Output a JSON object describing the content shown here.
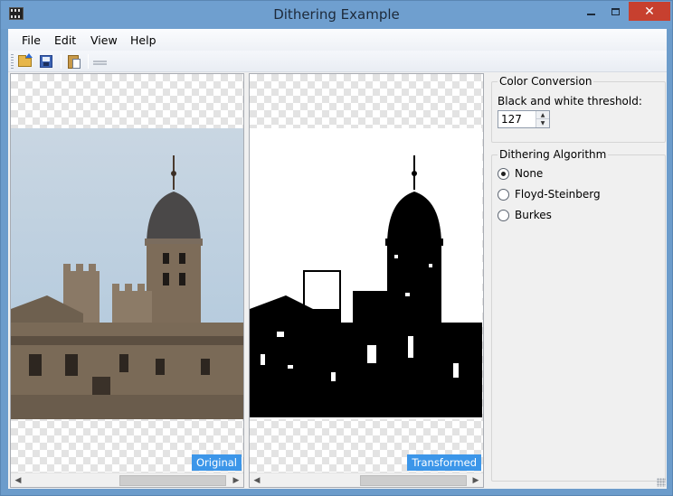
{
  "window": {
    "title": "Dithering Example",
    "close_glyph": "✕"
  },
  "menu": {
    "items": [
      "File",
      "Edit",
      "View",
      "Help"
    ]
  },
  "toolbar": {
    "buttons": [
      "open-icon",
      "save-icon",
      "paste-icon",
      "separator-disabled-icon"
    ]
  },
  "panels": {
    "original": {
      "badge": "Original"
    },
    "transformed": {
      "badge": "Transformed"
    }
  },
  "color_conversion": {
    "title": "Color Conversion",
    "threshold_label": "Black and white threshold:",
    "threshold_value": "127"
  },
  "dithering": {
    "title": "Dithering Algorithm",
    "options": [
      {
        "label": "None",
        "checked": true
      },
      {
        "label": "Floyd-Steinberg",
        "checked": false
      },
      {
        "label": "Burkes",
        "checked": false
      }
    ]
  },
  "colors": {
    "accent": "#3c96e9",
    "titlebar": "#6f9fcf",
    "close": "#c7402f"
  }
}
